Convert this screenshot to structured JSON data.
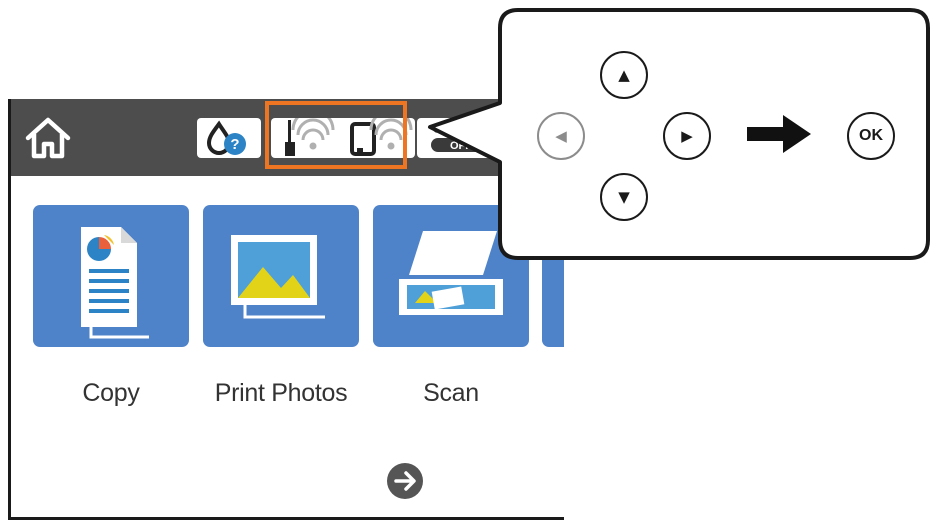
{
  "topbar": {
    "home_icon": "home-icon",
    "ink_icon": "ink-help-icon",
    "network_icon": "wifi-router-icon",
    "wifi_direct_icon": "wifi-direct-phone-icon",
    "off_badge": "OFF"
  },
  "menu": {
    "items": [
      {
        "label": "Copy",
        "icon": "copy-document-icon"
      },
      {
        "label": "Print Photos",
        "icon": "photo-icon"
      },
      {
        "label": "Scan",
        "icon": "scanner-icon"
      }
    ],
    "next_icon": "arrow-right-circle-icon"
  },
  "callout": {
    "up_key": "▲",
    "down_key": "▼",
    "left_key": "◀",
    "right_key": "▶",
    "ok_key": "OK",
    "then_icon": "thick-right-arrow-icon"
  },
  "colors": {
    "topbar": "#4d4d4d",
    "tile": "#4f83c9",
    "highlight": "#ee7623"
  }
}
